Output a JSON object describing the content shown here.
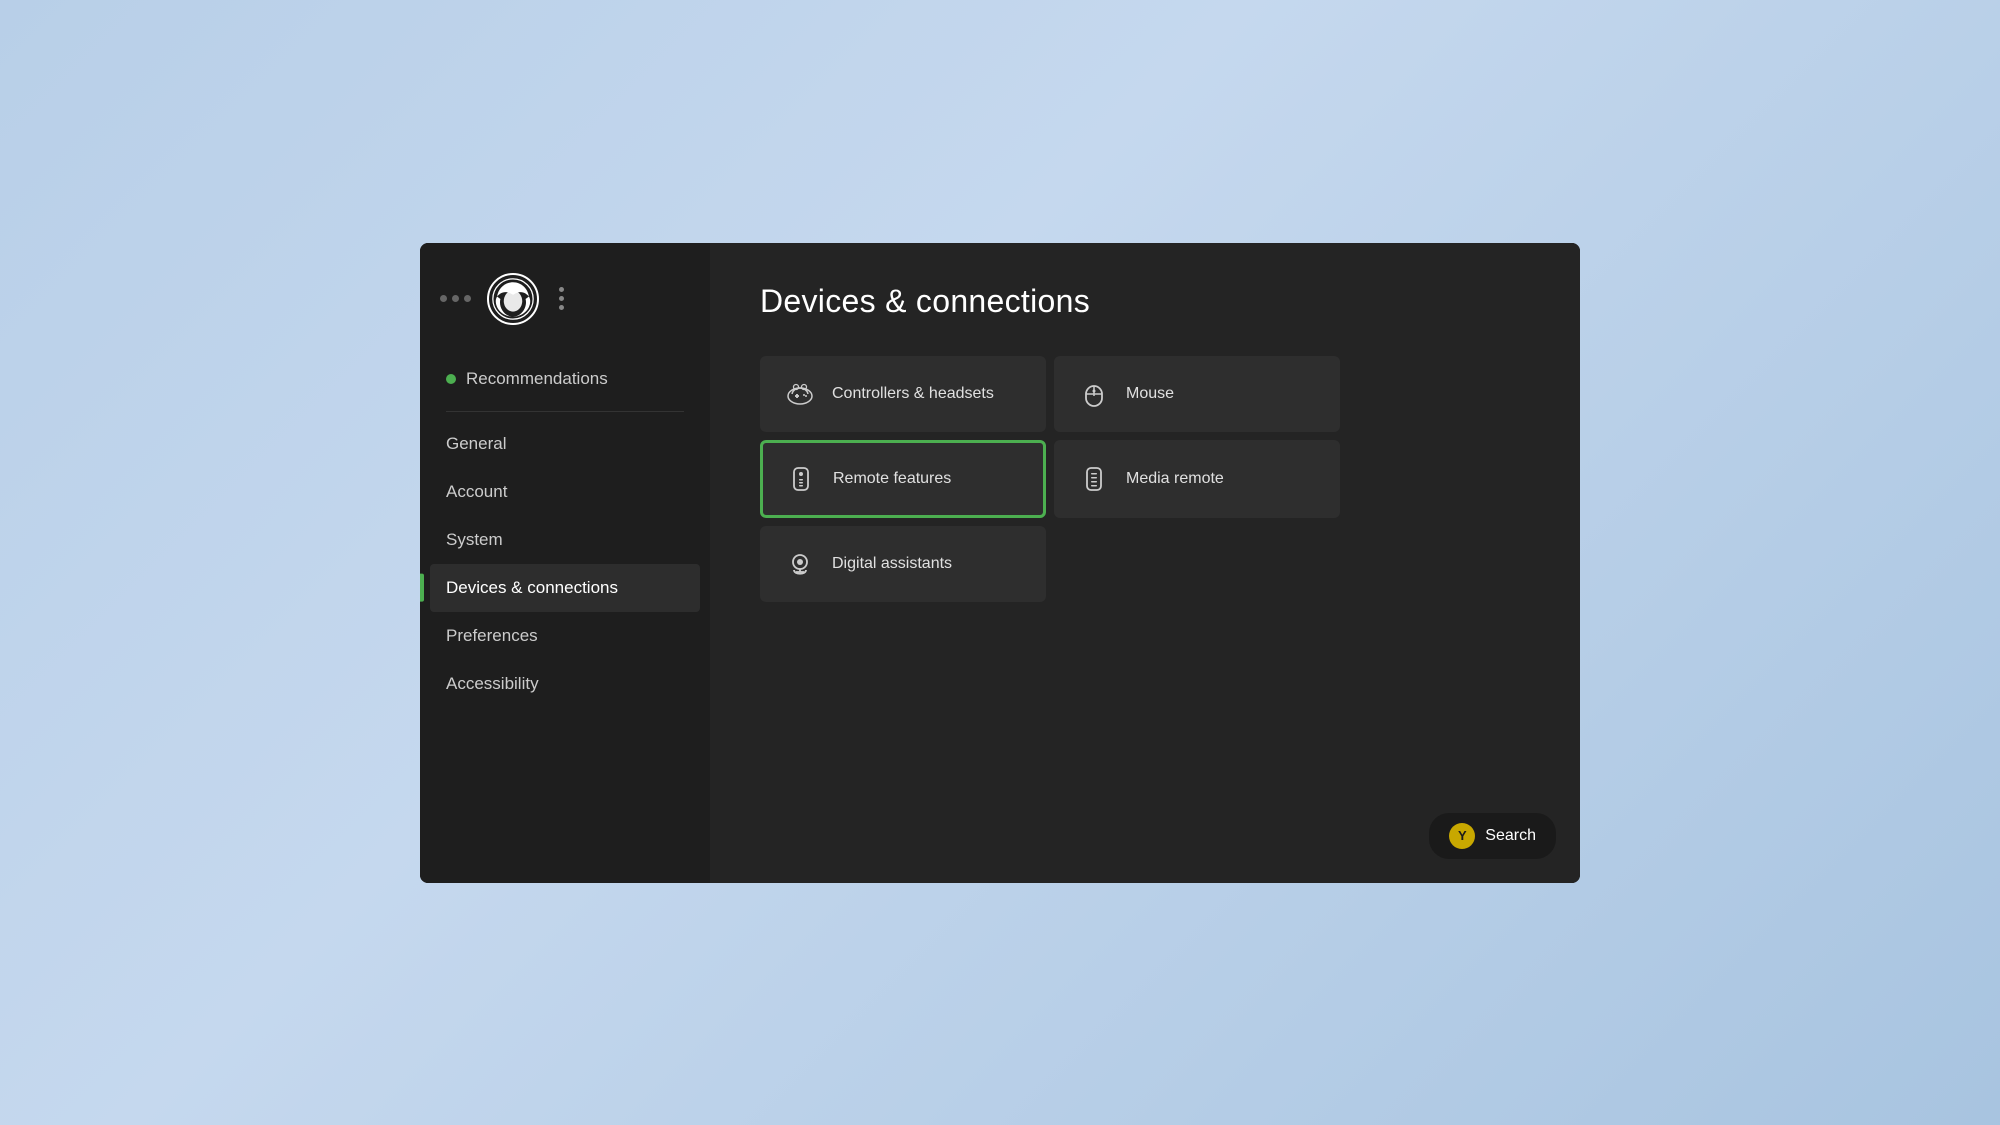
{
  "window": {
    "title": "Devices & connections"
  },
  "sidebar": {
    "recommendations_label": "Recommendations",
    "items": [
      {
        "id": "general",
        "label": "General",
        "active": false
      },
      {
        "id": "account",
        "label": "Account",
        "active": false
      },
      {
        "id": "system",
        "label": "System",
        "active": false
      },
      {
        "id": "devices",
        "label": "Devices & connections",
        "active": true
      },
      {
        "id": "preferences",
        "label": "Preferences",
        "active": false
      },
      {
        "id": "accessibility",
        "label": "Accessibility",
        "active": false
      }
    ]
  },
  "main": {
    "page_title": "Devices & connections",
    "grid_items": [
      {
        "id": "controllers",
        "label": "Controllers & headsets",
        "selected": false
      },
      {
        "id": "mouse",
        "label": "Mouse",
        "selected": false
      },
      {
        "id": "remote-features",
        "label": "Remote features",
        "selected": true
      },
      {
        "id": "media-remote",
        "label": "Media remote",
        "selected": false
      },
      {
        "id": "digital-assistants",
        "label": "Digital assistants",
        "selected": false
      }
    ]
  },
  "search_button": {
    "label": "Search",
    "button_key": "Y"
  }
}
